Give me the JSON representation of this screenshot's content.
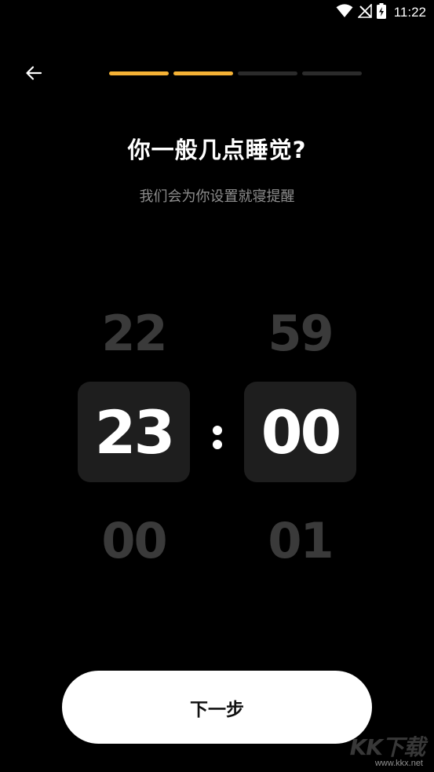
{
  "status_bar": {
    "time": "11:22",
    "icons": [
      "wifi-icon",
      "no-signal-icon",
      "battery-charging-icon"
    ]
  },
  "header": {
    "back_icon": "arrow-left-icon",
    "progress": {
      "total_steps": 4,
      "completed_steps": 2,
      "active_color": "#f5b235",
      "inactive_color": "#2b2b2b"
    }
  },
  "title": "你一般几点睡觉?",
  "subtitle": "我们会为你设置就寝提醒",
  "picker": {
    "hours": {
      "prev": "22",
      "selected": "23",
      "next": "00"
    },
    "separator": ":",
    "minutes": {
      "prev": "59",
      "selected": "00",
      "next": "01"
    }
  },
  "next_button": {
    "label": "下一步"
  },
  "watermark": {
    "logo_text": "KK下载",
    "url": "www.kkx.net"
  }
}
